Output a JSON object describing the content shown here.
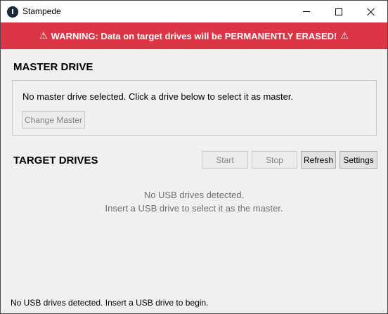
{
  "window": {
    "title": "Stampede",
    "app_icon": "stampede-app-icon",
    "controls": {
      "minimize": "minimize-icon",
      "maximize": "maximize-icon",
      "close": "close-icon"
    }
  },
  "warning": {
    "icon": "⚠",
    "text": "WARNING: Data on target drives will be PERMANENTLY ERASED!",
    "background_color": "#dc3545"
  },
  "master": {
    "heading": "MASTER DRIVE",
    "message": "No master drive selected. Click a drive below to select it as master.",
    "change_button": "Change Master"
  },
  "targets": {
    "heading": "TARGET DRIVES",
    "buttons": {
      "start": "Start",
      "stop": "Stop",
      "refresh": "Refresh",
      "settings": "Settings"
    },
    "empty_line1": "No USB drives detected.",
    "empty_line2": "Insert a USB drive to select it as the master."
  },
  "status": {
    "text": "No USB drives detected. Insert a USB drive to begin."
  }
}
